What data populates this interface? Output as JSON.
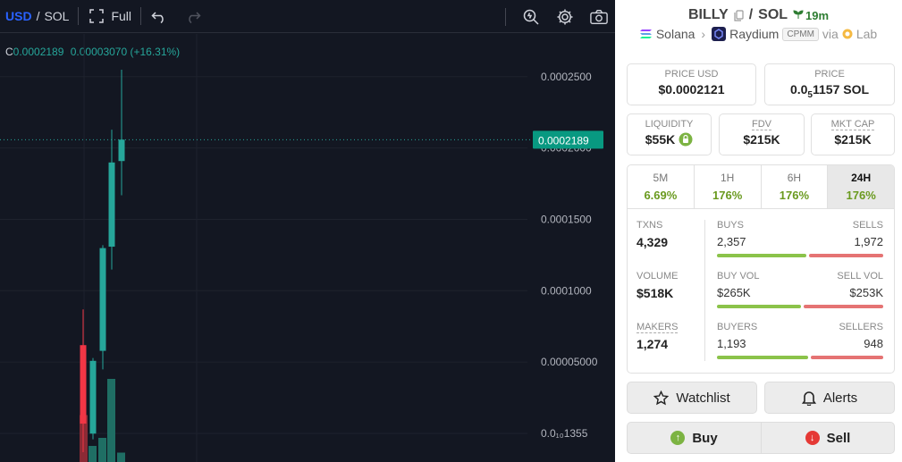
{
  "toolbar": {
    "base": "USD",
    "slash": "/",
    "quote": "SOL",
    "full_label": "Full"
  },
  "legend": {
    "c_label": "C",
    "price": "0.0002189",
    "change": "0.00003070 (+16.31%)"
  },
  "chart_data": {
    "type": "candlestick",
    "y_ticks": [
      "0.0002500",
      "0.0002000",
      "0.0001500",
      "0.0001000",
      "0.00005000",
      "0.0₁₀1355"
    ],
    "y_tick_values": [
      0.00025,
      0.0002,
      0.00015,
      0.0001,
      5e-05,
      1.355e-10
    ],
    "current_price_label": "0.0002189",
    "current_price": 0.0002189,
    "candles": [
      {
        "open": 7.5e-05,
        "high": 0.0001,
        "low": 0.0,
        "close": 2e-05,
        "color": "#f23645"
      },
      {
        "open": 1.3e-05,
        "high": 6.6e-05,
        "low": 9e-06,
        "close": 6.4e-05,
        "color": "#26a69a"
      },
      {
        "open": 7.1e-05,
        "high": 0.000145,
        "low": 5.8e-05,
        "close": 0.000143,
        "color": "#26a69a"
      },
      {
        "open": 0.000144,
        "high": 0.000226,
        "low": 0.000128,
        "close": 0.000203,
        "color": "#26a69a"
      },
      {
        "open": 0.000204,
        "high": 0.000268,
        "low": 0.00018,
        "close": 0.000219,
        "color": "#26a69a"
      }
    ],
    "volumes": [
      0.35,
      0.12,
      0.18,
      0.62,
      0.07
    ],
    "volume_colors": [
      "#8b2a35",
      "#1f6e64",
      "#1f6e64",
      "#1f6e64",
      "#1f6e64"
    ]
  },
  "pair": {
    "token": "BILLY",
    "slash": "/",
    "quote": "SOL",
    "age": "19m",
    "chain": "Solana",
    "dex": "Raydium",
    "pool_type": "CPMM",
    "via": "via",
    "via_source": "Lab"
  },
  "metrics": {
    "price_usd_label": "PRICE USD",
    "price_usd": "$0.0002121",
    "price_label": "PRICE",
    "price_sol_a": "0.0",
    "price_sol_sub": "5",
    "price_sol_b": "1157 SOL",
    "liquidity_label": "LIQUIDITY",
    "liquidity": "$55K",
    "fdv_label": "FDV",
    "fdv": "$215K",
    "mcap_label": "MKT CAP",
    "mcap": "$215K"
  },
  "tabs": [
    {
      "label": "5M",
      "pct": "6.69%"
    },
    {
      "label": "1H",
      "pct": "176%"
    },
    {
      "label": "6H",
      "pct": "176%"
    },
    {
      "label": "24H",
      "pct": "176%"
    }
  ],
  "stats": {
    "txns_label": "TXNS",
    "txns": "4,329",
    "buys_label": "BUYS",
    "buys": "2,357",
    "sells_label": "SELLS",
    "sells": "1,972",
    "volume_label": "VOLUME",
    "volume": "$518K",
    "buy_vol_label": "BUY VOL",
    "buy_vol": "$265K",
    "sell_vol_label": "SELL VOL",
    "sell_vol": "$253K",
    "makers_label": "MAKERS",
    "makers": "1,274",
    "buyers_label": "BUYERS",
    "buyers": "1,193",
    "sellers_label": "SELLERS",
    "sellers": "948",
    "buys_fraction": 0.544,
    "buy_vol_fraction": 0.512,
    "buyers_fraction": 0.557
  },
  "actions": {
    "watchlist": "Watchlist",
    "alerts": "Alerts",
    "buy": "Buy",
    "sell": "Sell"
  },
  "colors": {
    "up": "#26a69a",
    "down": "#f23645",
    "accent_usd": "#2962ff",
    "buy_green": "#8bc34a",
    "sell_red": "#e57373"
  }
}
